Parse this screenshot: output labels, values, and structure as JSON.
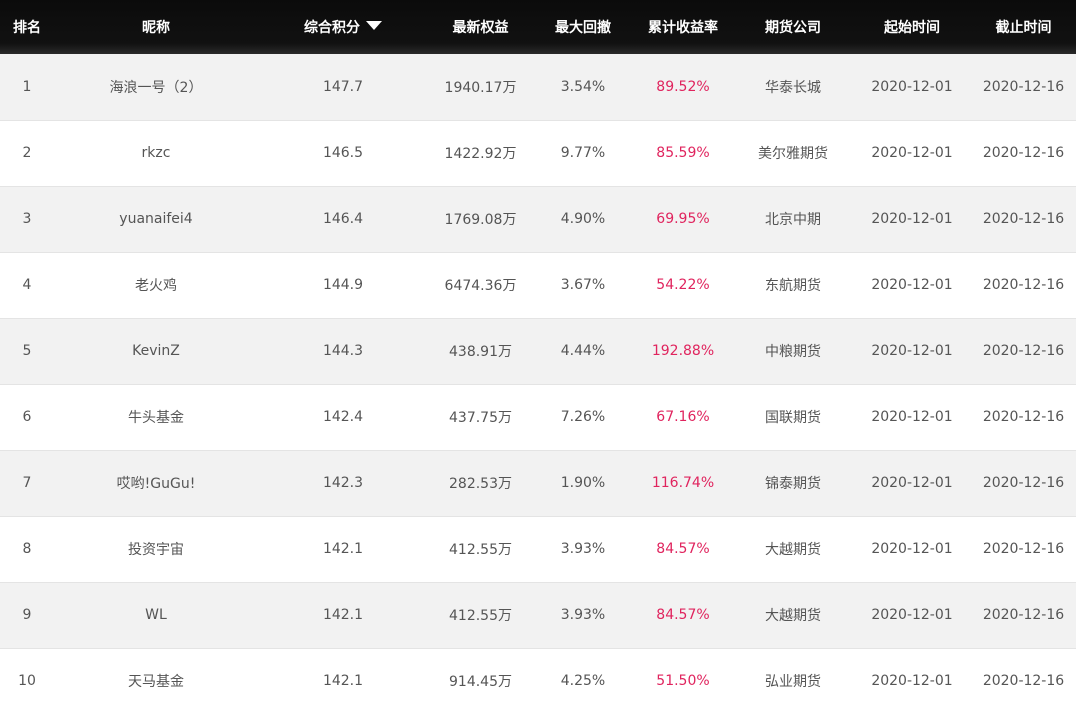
{
  "columns": {
    "rank": "排名",
    "nickname": "昵称",
    "score": "综合积分",
    "equity": "最新权益",
    "drawdown": "最大回撤",
    "return": "累计收益率",
    "company": "期货公司",
    "start": "起始时间",
    "end": "截止时间"
  },
  "colors": {
    "header_bg": "#111111",
    "return_text": "#e0245e",
    "row_alt": "#f2f2f2"
  },
  "rows": [
    {
      "rank": "1",
      "nickname": "海浪一号（2）",
      "score": "147.7",
      "equity": "1940.17万",
      "drawdown": "3.54%",
      "return": "89.52%",
      "company": "华泰长城",
      "start": "2020-12-01",
      "end": "2020-12-16"
    },
    {
      "rank": "2",
      "nickname": "rkzc",
      "score": "146.5",
      "equity": "1422.92万",
      "drawdown": "9.77%",
      "return": "85.59%",
      "company": "美尔雅期货",
      "start": "2020-12-01",
      "end": "2020-12-16"
    },
    {
      "rank": "3",
      "nickname": "yuanaifei4",
      "score": "146.4",
      "equity": "1769.08万",
      "drawdown": "4.90%",
      "return": "69.95%",
      "company": "北京中期",
      "start": "2020-12-01",
      "end": "2020-12-16"
    },
    {
      "rank": "4",
      "nickname": "老火鸡",
      "score": "144.9",
      "equity": "6474.36万",
      "drawdown": "3.67%",
      "return": "54.22%",
      "company": "东航期货",
      "start": "2020-12-01",
      "end": "2020-12-16"
    },
    {
      "rank": "5",
      "nickname": "KevinZ",
      "score": "144.3",
      "equity": "438.91万",
      "drawdown": "4.44%",
      "return": "192.88%",
      "company": "中粮期货",
      "start": "2020-12-01",
      "end": "2020-12-16"
    },
    {
      "rank": "6",
      "nickname": "牛头基金",
      "score": "142.4",
      "equity": "437.75万",
      "drawdown": "7.26%",
      "return": "67.16%",
      "company": "国联期货",
      "start": "2020-12-01",
      "end": "2020-12-16"
    },
    {
      "rank": "7",
      "nickname": "哎哟!GuGu!",
      "score": "142.3",
      "equity": "282.53万",
      "drawdown": "1.90%",
      "return": "116.74%",
      "company": "锦泰期货",
      "start": "2020-12-01",
      "end": "2020-12-16"
    },
    {
      "rank": "8",
      "nickname": "投资宇宙",
      "score": "142.1",
      "equity": "412.55万",
      "drawdown": "3.93%",
      "return": "84.57%",
      "company": "大越期货",
      "start": "2020-12-01",
      "end": "2020-12-16"
    },
    {
      "rank": "9",
      "nickname": "WL",
      "score": "142.1",
      "equity": "412.55万",
      "drawdown": "3.93%",
      "return": "84.57%",
      "company": "大越期货",
      "start": "2020-12-01",
      "end": "2020-12-16"
    },
    {
      "rank": "10",
      "nickname": "天马基金",
      "score": "142.1",
      "equity": "914.45万",
      "drawdown": "4.25%",
      "return": "51.50%",
      "company": "弘业期货",
      "start": "2020-12-01",
      "end": "2020-12-16"
    }
  ]
}
